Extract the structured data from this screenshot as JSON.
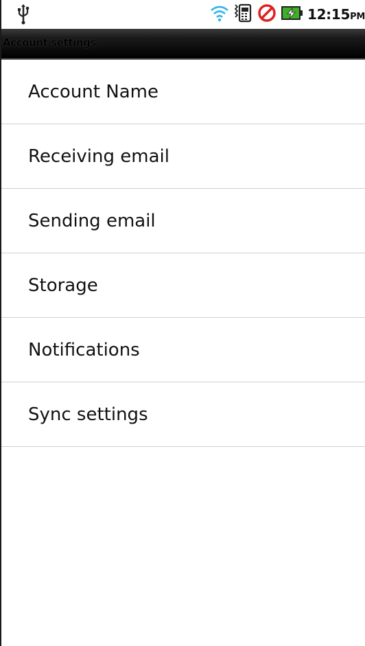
{
  "status_bar": {
    "time": "12:15",
    "ampm": "PM",
    "icons": [
      "usb-icon",
      "wifi-icon",
      "vibrate-icon",
      "no-signal-icon",
      "battery-charging-icon"
    ],
    "colors": {
      "wifi": "#33b5e5",
      "no_signal": "#e02020",
      "battery": "#3fae29"
    }
  },
  "header": {
    "title": "Account settings"
  },
  "settings": {
    "items": [
      {
        "label": "Account Name"
      },
      {
        "label": "Receiving email"
      },
      {
        "label": "Sending email"
      },
      {
        "label": "Storage"
      },
      {
        "label": "Notifications"
      },
      {
        "label": "Sync settings"
      }
    ]
  }
}
